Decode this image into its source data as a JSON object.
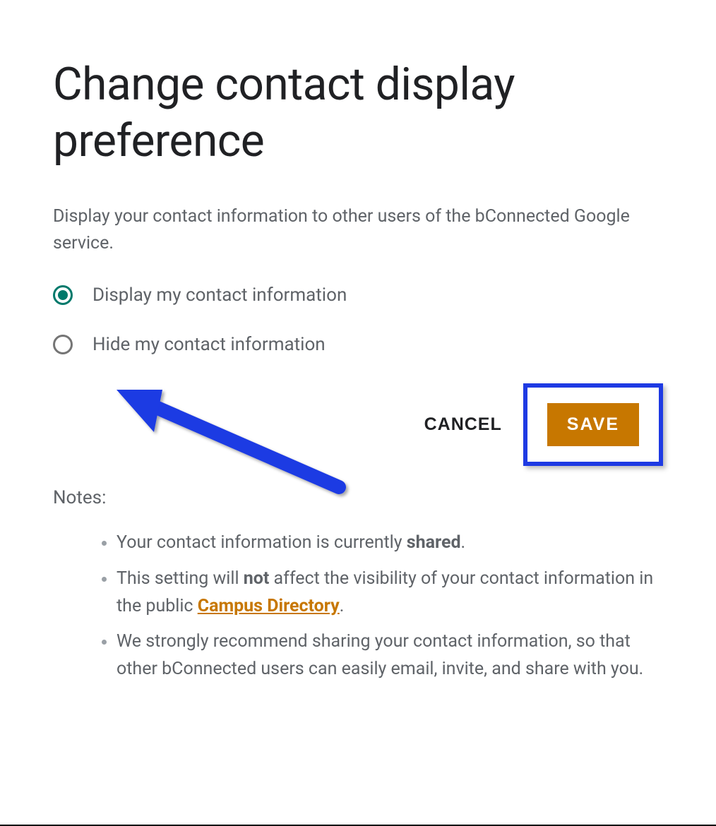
{
  "heading": "Change contact display preference",
  "subtitle": "Display your contact information to other users of the bConnected Google service.",
  "options": {
    "display": "Display my contact information",
    "hide": "Hide my contact information"
  },
  "actions": {
    "cancel": "CANCEL",
    "save": "SAVE"
  },
  "notes_heading": "Notes:",
  "notes": {
    "n1a": "Your contact information is currently ",
    "n1b": "shared",
    "n1c": ".",
    "n2a": "This setting will ",
    "n2b": "not",
    "n2c": " affect the visibility of your contact information in the public ",
    "n2link": "Campus Directory",
    "n2d": ".",
    "n3": "We strongly recommend sharing your contact information, so that other bConnected users can easily email, invite, and share with you."
  }
}
